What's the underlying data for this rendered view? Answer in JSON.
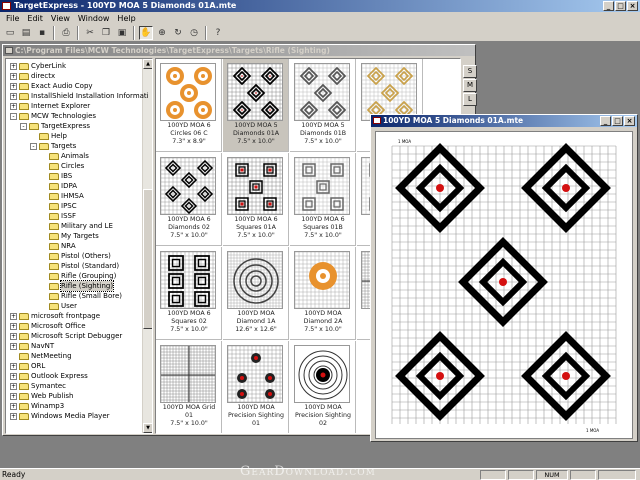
{
  "app": {
    "title": "TargetExpress - 100YD MOA 5 Diamonds 01A.mte"
  },
  "menu": [
    "File",
    "Edit",
    "View",
    "Window",
    "Help"
  ],
  "toolbar": {
    "icons": [
      "new-icon",
      "open-icon",
      "save-icon",
      "print-icon",
      "cut-icon",
      "copy-icon",
      "paste-icon",
      "hand-icon",
      "zoom-icon",
      "rotate-icon",
      "clock-icon",
      "help-icon"
    ],
    "pressed": "hand-icon"
  },
  "browser": {
    "title": "C:\\Program Files\\MCW Technologies\\TargetExpress\\Targets\\Rifle (Sighting)",
    "tree": [
      {
        "label": "CyberLink",
        "indent": 0,
        "exp": "+"
      },
      {
        "label": "directx",
        "indent": 0,
        "exp": "+"
      },
      {
        "label": "Exact Audio Copy",
        "indent": 0,
        "exp": "+"
      },
      {
        "label": "InstallShield Installation Informati",
        "indent": 0,
        "exp": "+"
      },
      {
        "label": "Internet Explorer",
        "indent": 0,
        "exp": "+"
      },
      {
        "label": "MCW Technologies",
        "indent": 0,
        "exp": "-"
      },
      {
        "label": "TargetExpress",
        "indent": 1,
        "exp": "-"
      },
      {
        "label": "Help",
        "indent": 2,
        "exp": ""
      },
      {
        "label": "Targets",
        "indent": 2,
        "exp": "-"
      },
      {
        "label": "Animals",
        "indent": 3,
        "exp": ""
      },
      {
        "label": "Circles",
        "indent": 3,
        "exp": ""
      },
      {
        "label": "IBS",
        "indent": 3,
        "exp": ""
      },
      {
        "label": "IDPA",
        "indent": 3,
        "exp": ""
      },
      {
        "label": "IHMSA",
        "indent": 3,
        "exp": ""
      },
      {
        "label": "IPSC",
        "indent": 3,
        "exp": ""
      },
      {
        "label": "ISSF",
        "indent": 3,
        "exp": ""
      },
      {
        "label": "Military and LE",
        "indent": 3,
        "exp": ""
      },
      {
        "label": "My Targets",
        "indent": 3,
        "exp": ""
      },
      {
        "label": "NRA",
        "indent": 3,
        "exp": ""
      },
      {
        "label": "Pistol (Others)",
        "indent": 3,
        "exp": ""
      },
      {
        "label": "Pistol (Standard)",
        "indent": 3,
        "exp": ""
      },
      {
        "label": "Rifle (Grouping)",
        "indent": 3,
        "exp": ""
      },
      {
        "label": "Rifle (Sighting)",
        "indent": 3,
        "exp": "",
        "selected": true
      },
      {
        "label": "Rifle (Small Bore)",
        "indent": 3,
        "exp": ""
      },
      {
        "label": "User",
        "indent": 3,
        "exp": ""
      },
      {
        "label": "microsoft frontpage",
        "indent": 0,
        "exp": "+"
      },
      {
        "label": "Microsoft Office",
        "indent": 0,
        "exp": "+"
      },
      {
        "label": "Microsoft Script Debugger",
        "indent": 0,
        "exp": "+"
      },
      {
        "label": "NavNT",
        "indent": 0,
        "exp": "+"
      },
      {
        "label": "NetMeeting",
        "indent": 0,
        "exp": ""
      },
      {
        "label": "ORL",
        "indent": 0,
        "exp": "+"
      },
      {
        "label": "Outlook Express",
        "indent": 0,
        "exp": "+"
      },
      {
        "label": "Symantec",
        "indent": 0,
        "exp": "+"
      },
      {
        "label": "Web Publish",
        "indent": 0,
        "exp": "+"
      },
      {
        "label": "Winamp3",
        "indent": 0,
        "exp": "+"
      },
      {
        "label": "Windows Media Player",
        "indent": 0,
        "exp": "+"
      }
    ],
    "side_buttons": [
      "S",
      "M",
      "L"
    ],
    "thumbnails": [
      {
        "name": "100YD MOA 6",
        "line2": "Circles 06 C",
        "size": "7.3\" x 8.9\"",
        "kind": "orange-circles"
      },
      {
        "name": "100YD MOA 5",
        "line2": "Diamonds 01A",
        "size": "7.5\" x 10.0\"",
        "kind": "diamonds",
        "selected": true
      },
      {
        "name": "100YD MOA 5",
        "line2": "Diamonds 01B",
        "size": "7.5\" x 10.0\"",
        "kind": "diamonds-light"
      },
      {
        "name": "",
        "line2": "",
        "size": "",
        "kind": "diamonds-orange"
      },
      {
        "name": "100YD MOA 6",
        "line2": "Diamonds 02",
        "size": "7.5\" x 10.0\"",
        "kind": "diamonds6"
      },
      {
        "name": "100YD MOA 6",
        "line2": "Squares 01A",
        "size": "7.5\" x 10.0\"",
        "kind": "squares"
      },
      {
        "name": "100YD MOA 6",
        "line2": "Squares 01B",
        "size": "7.5\" x 10.0\"",
        "kind": "squares-light"
      },
      {
        "name": "1",
        "line2": "S",
        "size": "",
        "kind": "squares-light"
      },
      {
        "name": "100YD MOA 6",
        "line2": "Squares 02",
        "size": "7.5\" x 10.0\"",
        "kind": "squares2"
      },
      {
        "name": "100YD MOA",
        "line2": "Diamond 1A",
        "size": "12.6\" x 12.6\"",
        "kind": "bullseye-grey"
      },
      {
        "name": "100YD MOA",
        "line2": "Diamond 2A",
        "size": "7.5\" x 10.0\"",
        "kind": "orange-diamond"
      },
      {
        "name": "D",
        "line2": "",
        "size": "",
        "kind": "grid-partial"
      },
      {
        "name": "100YD MOA Grid",
        "line2": "01",
        "size": "7.5\" x 10.0\"",
        "kind": "grid"
      },
      {
        "name": "100YD MOA",
        "line2": "Precision Sighting",
        "size": "01",
        "kind": "precision1"
      },
      {
        "name": "100YD MOA",
        "line2": "Precision Sighting",
        "size": "02",
        "kind": "precision2"
      },
      {
        "name": "",
        "line2": "",
        "size": "",
        "kind": "blank"
      }
    ]
  },
  "preview": {
    "title": "100YD MOA 5 Diamonds 01A.mte",
    "label_top": "1 MOA",
    "label_bottom": "1 MOA"
  },
  "status": {
    "text": "Ready",
    "cells": [
      "",
      "",
      "NUM",
      "",
      ""
    ]
  },
  "watermark": "GearDownload.com",
  "colors": {
    "titlebar": "#0a246a",
    "face": "#d4d0c8",
    "orange": "#e8922e",
    "red": "#d41010"
  }
}
